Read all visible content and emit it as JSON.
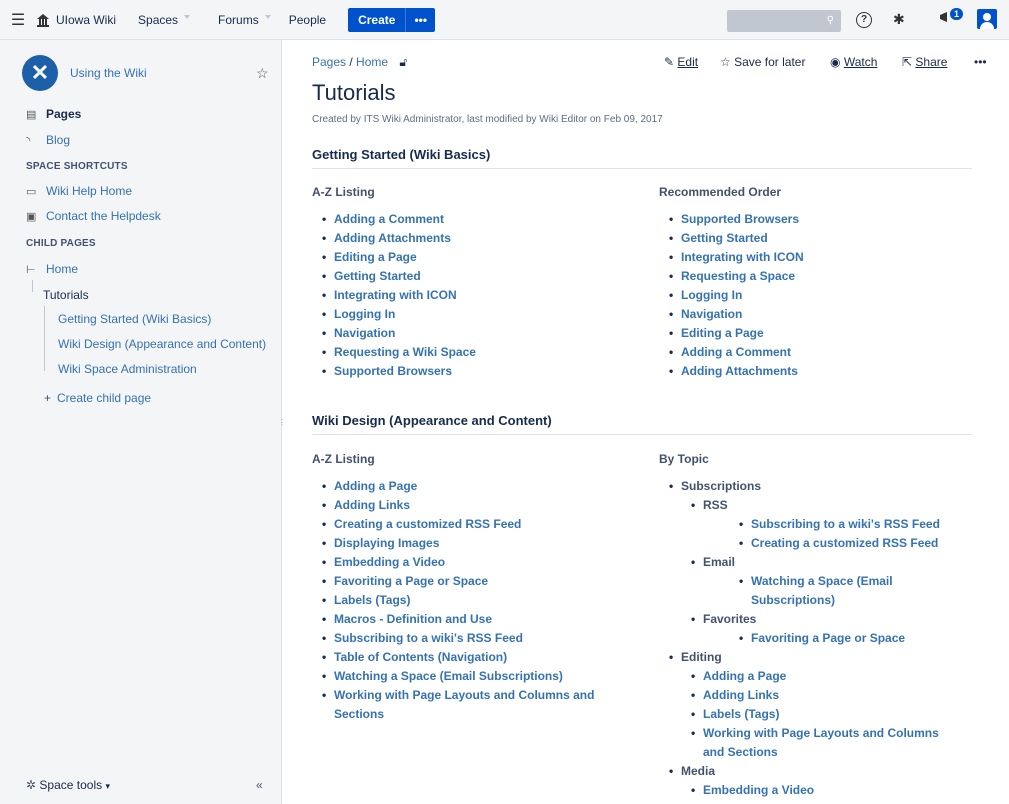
{
  "topbar": {
    "brand": "UIowa Wiki",
    "nav": [
      "Spaces",
      "Forums",
      "People"
    ],
    "create": "Create",
    "more": "•••",
    "notif_count": "1"
  },
  "sidebar": {
    "space_name": "Using the Wiki",
    "pages": "Pages",
    "blog": "Blog",
    "shortcuts_heading": "SPACE SHORTCUTS",
    "shortcuts": [
      "Wiki Help Home",
      "Contact the Helpdesk"
    ],
    "child_heading": "CHILD PAGES",
    "home": "Home",
    "tutorials": "Tutorials",
    "children": [
      "Getting Started (Wiki Basics)",
      "Wiki Design (Appearance and Content)",
      "Wiki Space Administration"
    ],
    "create_child": "Create child page",
    "space_tools": "Space tools"
  },
  "main": {
    "breadcrumb": [
      "Pages",
      "Home"
    ],
    "actions": {
      "edit": "Edit",
      "save": "Save for later",
      "watch": "Watch",
      "share": "Share",
      "more": "•••"
    },
    "title": "Tutorials",
    "byline": "Created by ITS Wiki Administrator, last modified by Wiki Editor on Feb 09, 2017",
    "s1": {
      "heading": "Getting Started (Wiki Basics)",
      "left_heading": "A-Z Listing",
      "left": [
        "Adding a Comment",
        "Adding Attachments",
        "Editing a Page",
        "Getting Started",
        "Integrating with ICON",
        "Logging In",
        "Navigation",
        "Requesting a Wiki Space",
        "Supported Browsers"
      ],
      "right_heading": "Recommended Order",
      "right": [
        "Supported Browsers",
        "Getting Started",
        "Integrating with ICON",
        "Requesting a Space",
        "Logging In",
        "Navigation",
        "Editing a Page",
        "Adding a Comment",
        "Adding Attachments"
      ]
    },
    "s2": {
      "heading": "Wiki Design (Appearance and Content)",
      "left_heading": "A-Z Listing",
      "left": [
        "Adding a Page",
        "Adding Links",
        "Creating a customized RSS Feed",
        "Displaying Images",
        "Embedding a Video",
        "Favoriting a Page or Space",
        "Labels (Tags)",
        "Macros - Definition and Use",
        "Subscribing to a wiki's RSS Feed",
        "Table of Contents (Navigation)",
        "Watching a Space (Email Subscriptions)",
        "Working with Page Layouts and Columns and Sections"
      ],
      "right_heading": "By Topic",
      "topics": {
        "subscriptions": "Subscriptions",
        "rss": "RSS",
        "rss_items": [
          "Subscribing to a wiki's RSS Feed",
          "Creating a customized RSS Feed"
        ],
        "email": "Email",
        "email_item": "Watching a Space (Email Subscriptions)",
        "favorites": "Favorites",
        "favorites_item": "Favoriting a Page or Space",
        "editing": "Editing",
        "editing_items": [
          "Adding a Page",
          "Adding Links",
          "Labels (Tags)",
          "Working with Page Layouts and Columns and Sections"
        ],
        "media": "Media",
        "media_item": "Embedding a Video"
      }
    }
  }
}
